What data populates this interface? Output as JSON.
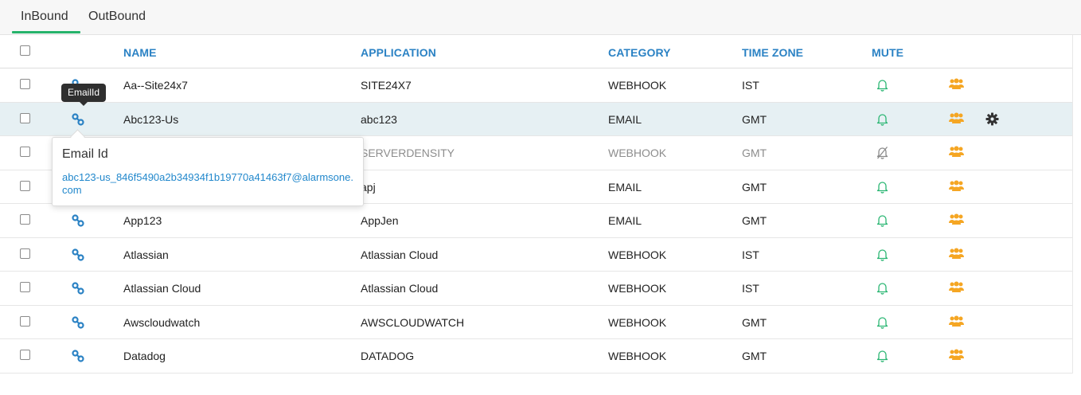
{
  "tabs": [
    {
      "label": "InBound",
      "active": true
    },
    {
      "label": "OutBound",
      "active": false
    }
  ],
  "accent_color": "#26b36b",
  "link_color": "#2b82c4",
  "columns": {
    "name": "NAME",
    "application": "APPLICATION",
    "category": "CATEGORY",
    "timezone": "TIME ZONE",
    "mute": "MUTE"
  },
  "rows": [
    {
      "name": "Aa--Site24x7",
      "application": "SITE24X7",
      "category": "WEBHOOK",
      "timezone": "IST",
      "muted": false,
      "icon": "link-icon"
    },
    {
      "name": "Abc123-Us",
      "application": "abc123",
      "category": "EMAIL",
      "timezone": "GMT",
      "muted": false,
      "icon": "link-icon",
      "highlighted": true
    },
    {
      "name": "",
      "application": "SERVERDENSITY",
      "category": "WEBHOOK",
      "timezone": "GMT",
      "muted": true,
      "icon": "link-icon"
    },
    {
      "name": "",
      "application": "apj",
      "category": "EMAIL",
      "timezone": "GMT",
      "muted": false,
      "icon": "link-icon"
    },
    {
      "name": "App123",
      "application": "AppJen",
      "category": "EMAIL",
      "timezone": "GMT",
      "muted": false,
      "icon": "link-icon"
    },
    {
      "name": "Atlassian",
      "application": "Atlassian Cloud",
      "category": "WEBHOOK",
      "timezone": "IST",
      "muted": false,
      "icon": "link-icon"
    },
    {
      "name": "Atlassian Cloud",
      "application": "Atlassian Cloud",
      "category": "WEBHOOK",
      "timezone": "IST",
      "muted": false,
      "icon": "link-icon"
    },
    {
      "name": "Awscloudwatch",
      "application": "AWSCLOUDWATCH",
      "category": "WEBHOOK",
      "timezone": "GMT",
      "muted": false,
      "icon": "link-icon"
    },
    {
      "name": "Datadog",
      "application": "DATADOG",
      "category": "WEBHOOK",
      "timezone": "GMT",
      "muted": false,
      "icon": "link-icon"
    }
  ],
  "tooltip": {
    "label": "EmailId"
  },
  "popover": {
    "title": "Email Id",
    "value": "abc123-us_846f5490a2b34934f1b19770a41463f7@alarmsone.com"
  },
  "icons": {
    "mute_on": "bell-icon",
    "mute_off": "bell-slash-icon",
    "group": "user-group-icon",
    "settings": "gear-icon"
  },
  "colors": {
    "bell": "#2bb673",
    "bell_off": "#8a8a8a",
    "group": "#f5a623",
    "gear": "#333333"
  }
}
